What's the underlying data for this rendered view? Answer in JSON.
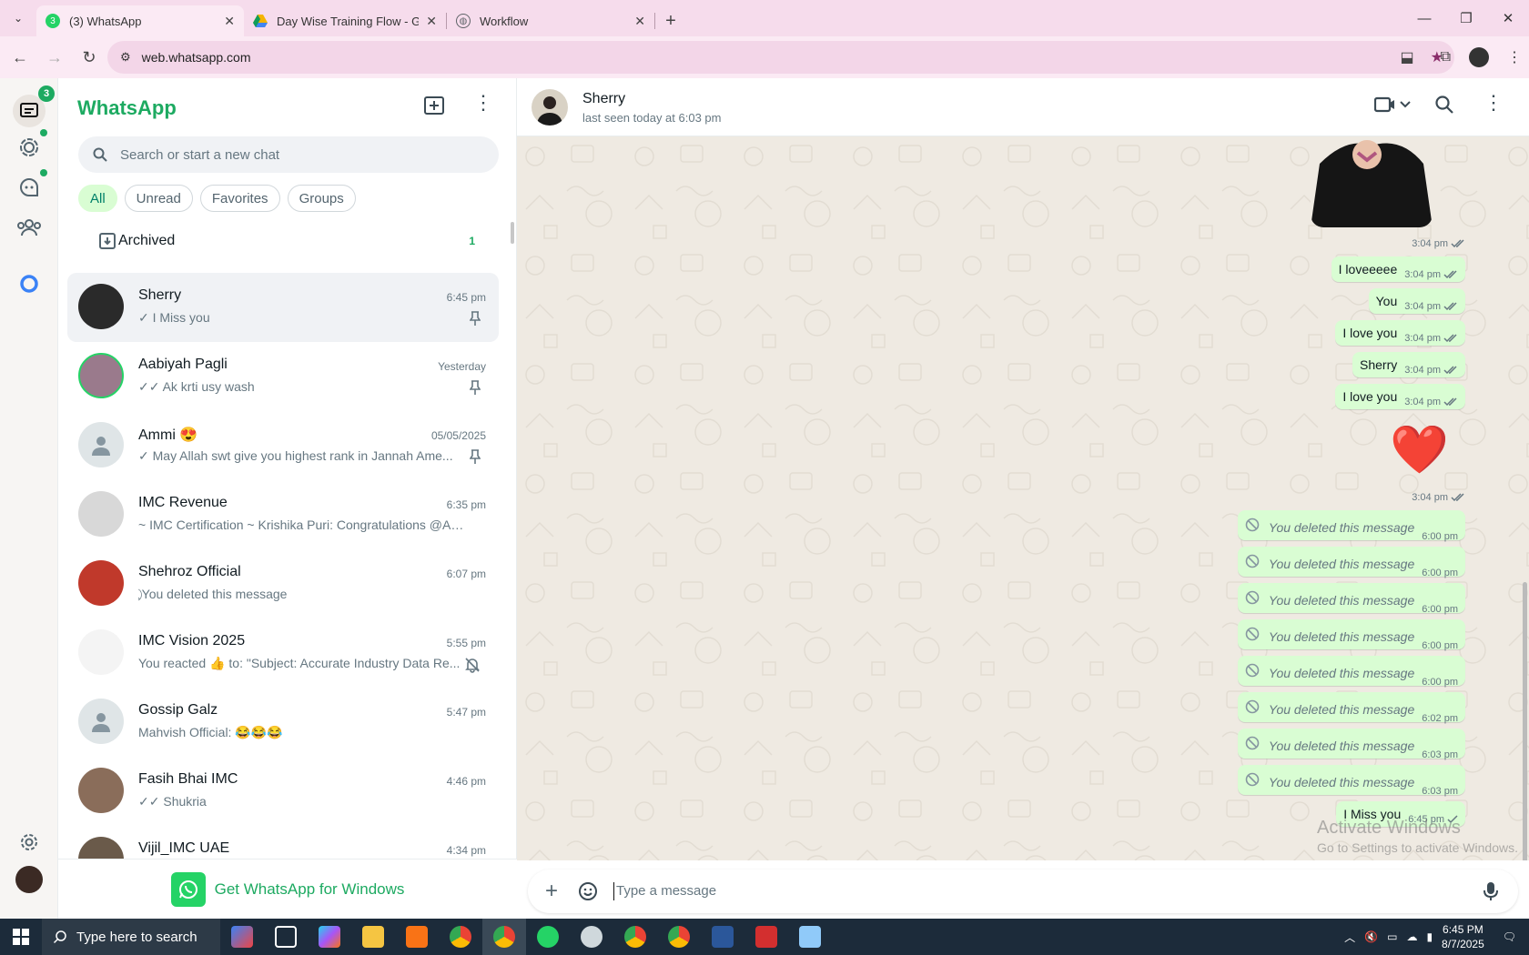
{
  "browser": {
    "tabs": [
      {
        "title": "(3) WhatsApp",
        "favicon_color": "#25d366"
      },
      {
        "title": "Day Wise Training Flow - Googl",
        "favicon_color": "#f4b400"
      },
      {
        "title": "Workflow",
        "favicon_color": "#5f6368"
      }
    ],
    "url": "web.whatsapp.com"
  },
  "rail": {
    "chats_badge": "3"
  },
  "sidebar": {
    "brand": "WhatsApp",
    "search_placeholder": "Search or start a new chat",
    "filters": [
      "All",
      "Unread",
      "Favorites",
      "Groups"
    ],
    "archived_label": "Archived",
    "archived_count": "1",
    "chats": [
      {
        "name": "Sherry",
        "time": "6:45 pm",
        "preview": "✓ I Miss you",
        "mark": "pin-icon",
        "avatar_color": "#2a2a2a"
      },
      {
        "name": "Aabiyah Pagli",
        "time": "Yesterday",
        "preview": "✓✓ Ak krti usy wash",
        "mark": "pin-icon",
        "avatar_color": "#9a7a8c"
      },
      {
        "name": "Ammi 😍",
        "time": "05/05/2025",
        "preview": "✓ May Allah swt give you highest rank in Jannah  Ame...",
        "mark": "pin-icon",
        "avatar_color": "#dfe5e7"
      },
      {
        "name": "IMC Revenue",
        "time": "6:35 pm",
        "preview": "~ IMC Certification ~ Krishika Puri: Congratulations @Aliya ...",
        "mark": "",
        "avatar_color": "#d8d8d8"
      },
      {
        "name": "Shehroz Official",
        "time": "6:07 pm",
        "preview": "⃠ You deleted this message",
        "mark": "",
        "avatar_color": "#c0392b"
      },
      {
        "name": "IMC Vision 2025",
        "time": "5:55 pm",
        "preview": "You reacted 👍 to: \"Subject: Accurate Industry Data Re...",
        "mark": "mute-icon",
        "avatar_color": "#f4f4f4"
      },
      {
        "name": "Gossip Galz",
        "time": "5:47 pm",
        "preview": "Mahvish Official: 😂😂😂",
        "mark": "",
        "avatar_color": "#dfe5e7"
      },
      {
        "name": "Fasih Bhai IMC",
        "time": "4:46 pm",
        "preview": "✓✓ Shukria",
        "mark": "",
        "avatar_color": "#8a6d5a"
      },
      {
        "name": "Vijil_IMC UAE",
        "time": "4:34 pm",
        "preview": "",
        "mark": "",
        "avatar_color": "#6a5a4a"
      }
    ],
    "get_app": "Get WhatsApp for Windows"
  },
  "conversation": {
    "name": "Sherry",
    "status": "last seen today at 6:03 pm",
    "messages": [
      {
        "kind": "time",
        "time": "3:04 pm"
      },
      {
        "kind": "text",
        "text": "I loveeeee",
        "time": "3:04 pm"
      },
      {
        "kind": "text",
        "text": "You",
        "time": "3:04 pm"
      },
      {
        "kind": "text",
        "text": "I love you",
        "time": "3:04 pm"
      },
      {
        "kind": "text",
        "text": "Sherry",
        "time": "3:04 pm"
      },
      {
        "kind": "text",
        "text": "I love you",
        "time": "3:04 pm"
      },
      {
        "kind": "heart",
        "text": "❤️"
      },
      {
        "kind": "time",
        "time": "3:04 pm"
      },
      {
        "kind": "deleted",
        "text": "You deleted this message",
        "time": "6:00 pm"
      },
      {
        "kind": "deleted",
        "text": "You deleted this message",
        "time": "6:00 pm"
      },
      {
        "kind": "deleted",
        "text": "You deleted this message",
        "time": "6:00 pm"
      },
      {
        "kind": "deleted",
        "text": "You deleted this message",
        "time": "6:00 pm"
      },
      {
        "kind": "deleted",
        "text": "You deleted this message",
        "time": "6:00 pm"
      },
      {
        "kind": "deleted",
        "text": "You deleted this message",
        "time": "6:02 pm"
      },
      {
        "kind": "deleted",
        "text": "You deleted this message",
        "time": "6:03 pm"
      },
      {
        "kind": "deleted",
        "text": "You deleted this message",
        "time": "6:03 pm"
      },
      {
        "kind": "text",
        "text": "I Miss you",
        "time": "6:45 pm",
        "single_tick": true
      }
    ],
    "composer_placeholder": "Type a message",
    "watermark_title": "Activate Windows",
    "watermark_sub": "Go to Settings to activate Windows."
  },
  "taskbar": {
    "search_placeholder": "Type here to search",
    "time": "6:45 PM",
    "date": "8/7/2025"
  }
}
